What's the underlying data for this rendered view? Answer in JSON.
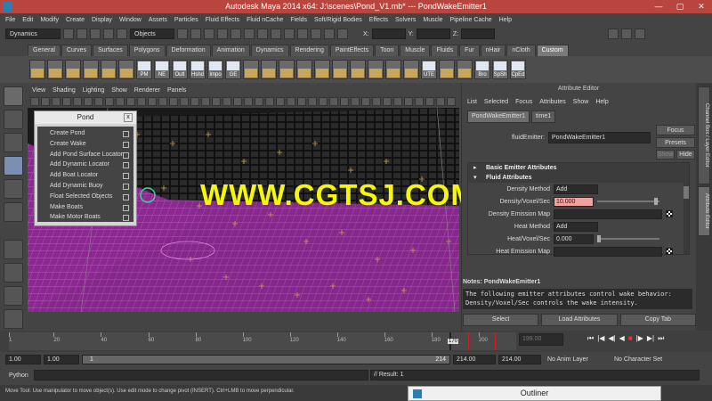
{
  "window_title": "Autodesk Maya 2014 x64: J:\\scenes\\Pond_V1.mb*  ---  PondWakeEmitter1",
  "window_controls": [
    "—",
    "▢",
    "✕"
  ],
  "menubar": [
    "File",
    "Edit",
    "Modify",
    "Create",
    "Display",
    "Window",
    "Assets",
    "Particles",
    "Fluid Effects",
    "Fluid nCache",
    "Fields",
    "Soft/Rigid Bodies",
    "Effects",
    "Solvers",
    "Muscle",
    "Pipeline Cache",
    "Help"
  ],
  "status_line": {
    "menuset": "Dynamics",
    "objects_label": "Objects",
    "x_label": "X:",
    "y_label": "Y:",
    "z_label": "Z:"
  },
  "shelf_tabs": [
    "General",
    "Curves",
    "Surfaces",
    "Polygons",
    "Deformation",
    "Animation",
    "Dynamics",
    "Rendering",
    "PaintEffects",
    "Toon",
    "Muscle",
    "Fluids",
    "Fur",
    "nHair",
    "nCloth",
    "Custom"
  ],
  "shelf_active": "Custom",
  "shelf_labels": [
    "",
    "",
    "",
    "",
    "",
    "",
    "PM",
    "NE",
    "Outl",
    "Hshd",
    "Impo",
    "GE",
    "",
    "",
    "",
    "",
    "",
    "",
    "",
    "",
    "",
    "",
    "UTE",
    "",
    "",
    "Bro",
    "SpSh",
    "CpEd"
  ],
  "viewport_menu": [
    "View",
    "Shading",
    "Lighting",
    "Show",
    "Renderer",
    "Panels"
  ],
  "pond_window": {
    "title": "Pond",
    "close": "x",
    "items": [
      "Create Pond",
      "Create Wake",
      "Add Pond Surface Locator",
      "Add Dynamic Locator",
      "Add Boat Locator",
      "Add Dynamic Buoy",
      "Float Selected Objects",
      "Make Boats",
      "Make Motor Boats"
    ]
  },
  "watermark": "WWW.CGTSJ.COM",
  "attr_editor": {
    "title": "Attribute Editor",
    "menu": [
      "List",
      "Selected",
      "Focus",
      "Attributes",
      "Show",
      "Help"
    ],
    "tabs": [
      "PondWakeEmitter1",
      "time1"
    ],
    "node_label": "fluidEmitter:",
    "node_value": "PondWakeEmitter1",
    "focus": "Focus",
    "presets": "Presets",
    "show": "Show",
    "hide": "Hide",
    "section1": "Basic Emitter Attributes",
    "section2": "Fluid Attributes",
    "density_method_label": "Density Method",
    "density_method_value": "Add",
    "density_voxel_label": "Density/Voxel/Sec",
    "density_voxel_value": "10.000",
    "density_map_label": "Density Emission Map",
    "heat_method_label": "Heat Method",
    "heat_method_value": "Add",
    "heat_voxel_label": "Heat/Voxel/Sec",
    "heat_voxel_value": "0.000",
    "heat_map_label": "Heat Emission Map",
    "notes_title": "Notes:  PondWakeEmitter1",
    "notes_line1": "The following emitter attributes control wake behavior:",
    "notes_line2": "Density/Voxel/Sec controls the wake intensity.",
    "buttons": [
      "Select",
      "Load Attributes",
      "Copy Tab"
    ]
  },
  "side_tabs": [
    "Channel Box / Layer Editor",
    "Attribute Editor"
  ],
  "timeline": {
    "ticks": [
      "1",
      "20",
      "40",
      "60",
      "80",
      "100",
      "120",
      "140",
      "160",
      "180",
      "200"
    ],
    "current": "170",
    "end_box": "199.00"
  },
  "range": {
    "start": "1.00",
    "start2": "1.00",
    "slider_start": "1",
    "slider_end": "214",
    "end": "214.00",
    "end2": "214.00",
    "anim_layer": "No Anim Layer",
    "char_set": "No Character Set"
  },
  "cmdline": {
    "label": "Python",
    "result": "// Result: 1"
  },
  "helpline": "Move Tool: Use manipulator to move object(s). Use edit mode to change pivot (INSERT).  Ctrl+LMB to move perpendicular.",
  "outliner_title": "Outliner",
  "colors": {
    "title_bar": "#b8463e",
    "watermark": "#f6f60b",
    "mesh": "#c030c8",
    "highlight": "#f0a2a0"
  }
}
